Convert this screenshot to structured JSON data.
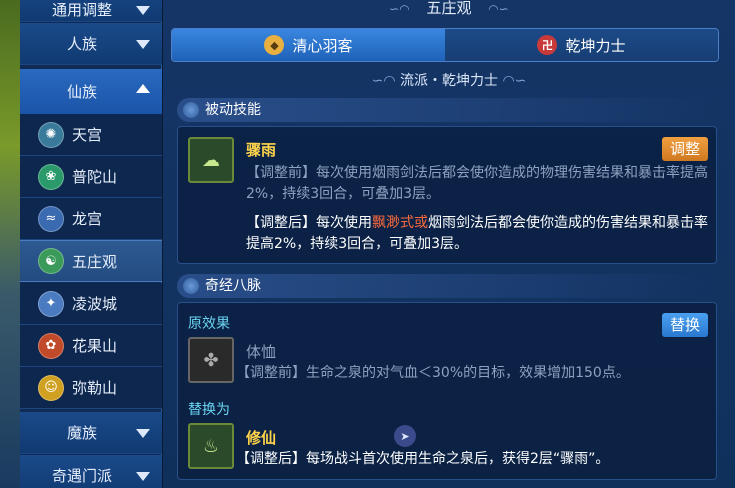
{
  "sidebar": {
    "top_category": "通用调整",
    "categories": [
      {
        "label": "人族"
      },
      {
        "label": "仙族"
      }
    ],
    "schools": [
      {
        "label": "天宫",
        "icon": "tiangong-emblem-icon",
        "color": "#3a7a9a"
      },
      {
        "label": "普陀山",
        "icon": "putuoshan-emblem-icon",
        "color": "#2a9a6a"
      },
      {
        "label": "龙宫",
        "icon": "longgong-emblem-icon",
        "color": "#3a6ab0"
      },
      {
        "label": "五庄观",
        "icon": "wuzhuangguan-emblem-icon",
        "color": "#3a9a5a"
      },
      {
        "label": "凌波城",
        "icon": "lingbocheng-emblem-icon",
        "color": "#4a7ac0"
      },
      {
        "label": "花果山",
        "icon": "huaguoshan-emblem-icon",
        "color": "#c04a2a"
      },
      {
        "label": "弥勒山",
        "icon": "mileshan-emblem-icon",
        "color": "#d0a020"
      }
    ],
    "bottom_categories": [
      {
        "label": "魔族"
      },
      {
        "label": "奇遇门派"
      }
    ]
  },
  "main": {
    "title": "五庄观",
    "tabs": [
      {
        "label": "清心羽客"
      },
      {
        "label": "乾坤力士"
      }
    ],
    "subtitle": "流派・乾坤力士",
    "passive_section": {
      "header": "被动技能",
      "skill_name": "骤雨",
      "badge": "调整",
      "before": "【调整前】每次使用烟雨剑法后都会使你造成的物理伤害结果和暴击率提高2%，持续3回合，可叠加3层。",
      "after_prefix": "【调整后】每次使用",
      "after_highlight": "飘渺式或",
      "after_suffix": "烟雨剑法后都会使你造成的伤害结果和暴击率提高2%，持续3回合，可叠加3层。"
    },
    "meridian_section": {
      "header": "奇经八脉",
      "original_label": "原效果",
      "replace_badge": "替换",
      "original_name": "体恤",
      "original_desc": "【调整前】生命之泉的对气血＜30%的目标，效果增加150点。",
      "replace_label": "替换为",
      "new_name": "修仙",
      "new_desc": "【调整后】每场战斗首次使用生命之泉后，获得2层“骤雨”。"
    }
  },
  "colors": {
    "accent": "#2a78d0",
    "highlight": "#ff6a3a",
    "skill_name": "#ffd34a",
    "badge_orange": "#e08a30"
  }
}
